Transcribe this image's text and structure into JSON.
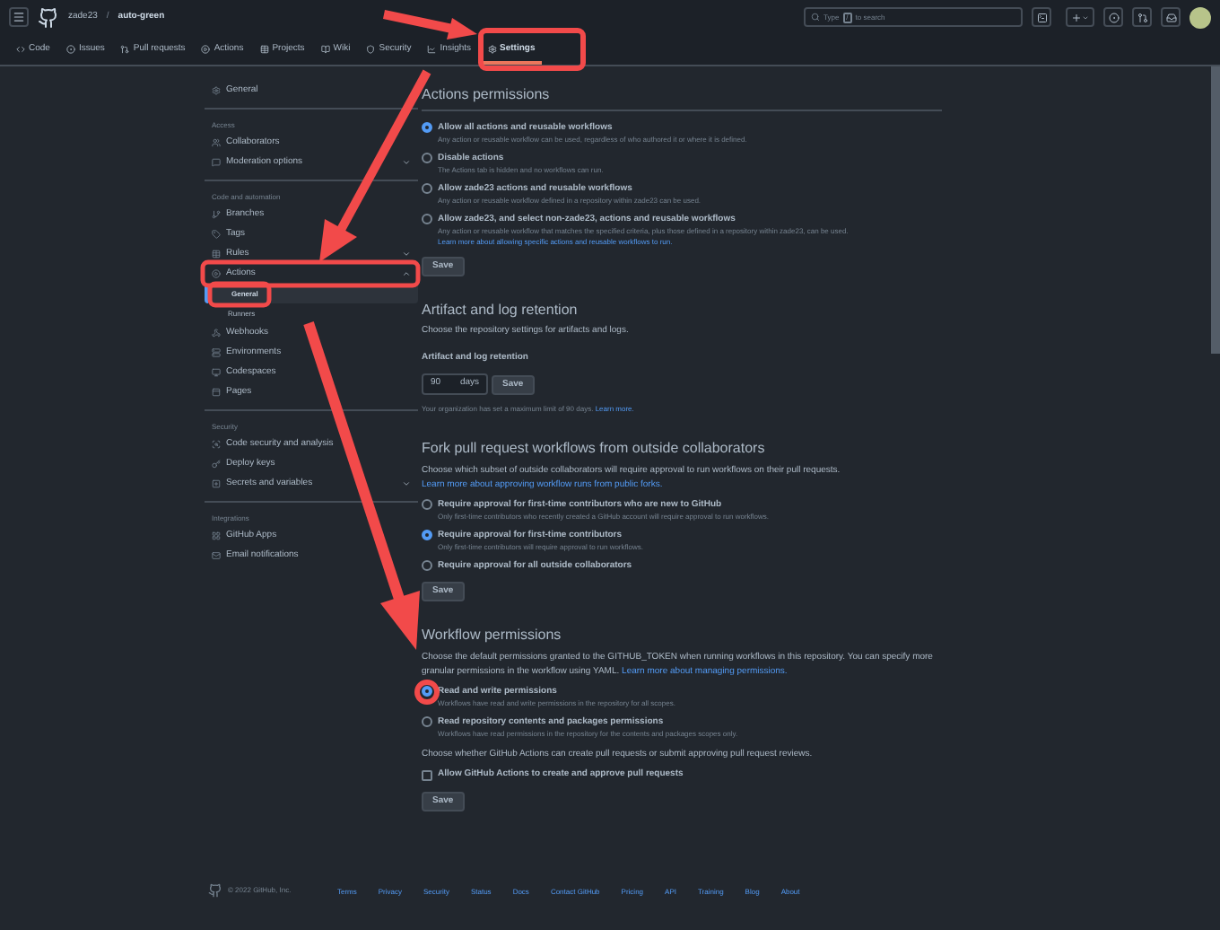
{
  "header": {
    "owner": "zade23",
    "separator": "/",
    "repo": "auto-green",
    "search": {
      "hint_1": "Type",
      "key": "/",
      "hint_2": "to search"
    }
  },
  "nav_tabs": [
    {
      "label": "Code",
      "selected": false
    },
    {
      "label": "Issues",
      "selected": false
    },
    {
      "label": "Pull requests",
      "selected": false
    },
    {
      "label": "Actions",
      "selected": false
    },
    {
      "label": "Projects",
      "selected": false
    },
    {
      "label": "Wiki",
      "selected": false
    },
    {
      "label": "Security",
      "selected": false
    },
    {
      "label": "Insights",
      "selected": false
    },
    {
      "label": "Settings",
      "selected": true
    }
  ],
  "sidebar": {
    "groups": [
      {
        "items": [
          {
            "label": "General",
            "selected": false
          }
        ]
      },
      {
        "heading": "Access",
        "items": [
          {
            "label": "Collaborators",
            "selected": false
          },
          {
            "label": "Moderation options",
            "selected": false,
            "expanded": false
          }
        ]
      },
      {
        "heading": "Code and automation",
        "items": [
          {
            "label": "Branches",
            "selected": false
          },
          {
            "label": "Tags",
            "selected": false
          },
          {
            "label": "Rules",
            "selected": false,
            "expanded": false
          },
          {
            "label": "Actions",
            "selected": false,
            "expanded": true,
            "children": [
              {
                "label": "General",
                "selected": true
              },
              {
                "label": "Runners",
                "selected": false
              }
            ]
          },
          {
            "label": "Webhooks",
            "selected": false
          },
          {
            "label": "Environments",
            "selected": false
          },
          {
            "label": "Codespaces",
            "selected": false
          },
          {
            "label": "Pages",
            "selected": false
          }
        ]
      },
      {
        "heading": "Security",
        "items": [
          {
            "label": "Code security and analysis",
            "selected": false
          },
          {
            "label": "Deploy keys",
            "selected": false
          },
          {
            "label": "Secrets and variables",
            "selected": false,
            "expanded": false
          }
        ]
      },
      {
        "heading": "Integrations",
        "items": [
          {
            "label": "GitHub Apps",
            "selected": false
          },
          {
            "label": "Email notifications",
            "selected": false
          }
        ]
      }
    ]
  },
  "sections": [
    {
      "kind": "options",
      "title": "Actions permissions",
      "options": [
        {
          "label": "Allow all actions and reusable workflows",
          "description": "Any action or reusable workflow can be used, regardless of who authored it or where it is defined.",
          "selected": true
        },
        {
          "label": "Disable actions",
          "description": "The Actions tab is hidden and no workflows can run.",
          "selected": false
        },
        {
          "label": "Allow zade23 actions and reusable workflows",
          "description": "Any action or reusable workflow defined in a repository within zade23 can be used.",
          "selected": false
        },
        {
          "label": "Allow zade23, and select non-zade23, actions and reusable workflows",
          "description": "Any action or reusable workflow that matches the specified criteria, plus those defined in a repository within zade23, can be used.",
          "link": "Learn more about allowing specific actions and reusable workflows to run.",
          "selected": false
        }
      ],
      "button": "Save"
    },
    {
      "kind": "retention",
      "title": "Artifact and log retention",
      "description": "Choose the repository settings for artifacts and logs.",
      "label": "Artifact and log retention",
      "value": "90",
      "unit": "days",
      "button": "Save",
      "note": "Your organization has set a maximum limit of 90 days.",
      "note_link": "Learn more."
    },
    {
      "kind": "options",
      "title": "Fork pull request workflows from outside collaborators",
      "description": "Choose which subset of outside collaborators will require approval to run workflows on their pull requests.",
      "link": "Learn more about approving workflow runs from public forks.",
      "options": [
        {
          "label": "Require approval for first-time contributors who are new to GitHub",
          "description": "Only first-time contributors who recently created a GitHub account will require approval to run workflows.",
          "selected": false
        },
        {
          "label": "Require approval for first-time contributors",
          "description": "Only first-time contributors will require approval to run workflows.",
          "selected": true
        },
        {
          "label": "Require approval for all outside collaborators",
          "selected": false
        }
      ],
      "button": "Save"
    },
    {
      "kind": "options",
      "title": "Workflow permissions",
      "description": "Choose the default permissions granted to the GITHUB_TOKEN when running workflows in this repository. You can specify more granular permissions in the workflow using YAML.",
      "link": "Learn more about managing permissions.",
      "options": [
        {
          "label": "Read and write permissions",
          "description": "Workflows have read and write permissions in the repository for all scopes.",
          "selected": true
        },
        {
          "label": "Read repository contents and packages permissions",
          "description": "Workflows have read permissions in the repository for the contents and packages scopes only.",
          "selected": false
        }
      ],
      "extra_text": "Choose whether GitHub Actions can create pull requests or submit approving pull request reviews.",
      "checkbox": {
        "label": "Allow GitHub Actions to create and approve pull requests",
        "checked": false
      },
      "button": "Save"
    }
  ],
  "footer": {
    "copyright": "© 2022 GitHub, Inc.",
    "links": [
      "Terms",
      "Privacy",
      "Security",
      "Status",
      "Docs",
      "Contact GitHub",
      "Pricing",
      "API",
      "Training",
      "Blog",
      "About"
    ]
  }
}
